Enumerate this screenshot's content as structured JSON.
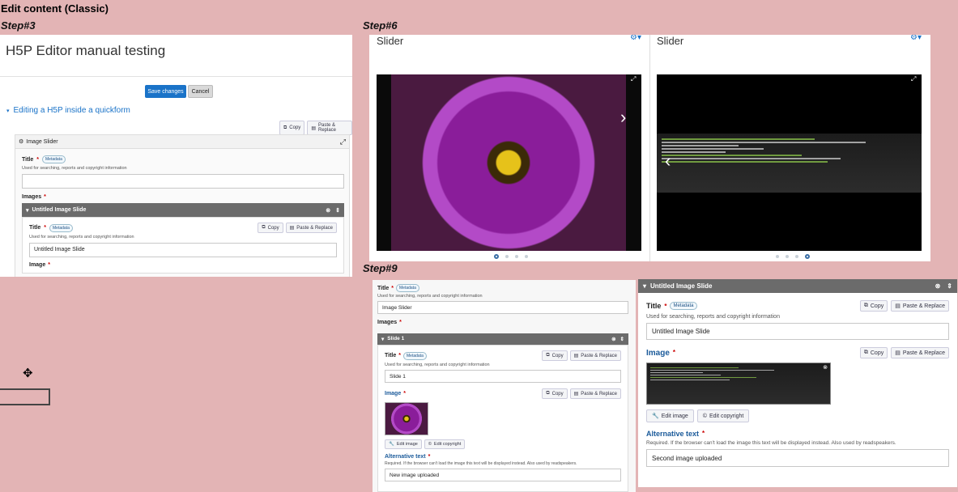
{
  "header": {
    "title": "Edit content (Classic)"
  },
  "steps": {
    "step3": "Step#3",
    "step6": "Step#6",
    "step9": "Step#9"
  },
  "step3": {
    "page_title": "H5P Editor manual testing",
    "save_label": "Save changes",
    "cancel_label": "Cancel",
    "section_label": "Editing a H5P inside a quickform",
    "copy_label": "Copy",
    "paste_label": "Paste & Replace",
    "widget_label": "Image Slider",
    "title_label": "Title",
    "metadata_label": "Metadata",
    "title_desc": "Used for searching, reports and copyright information",
    "images_label": "Images",
    "slide_bar_label": "Untitled Image Slide",
    "slide_title_value": "Untitled Image Slide",
    "image_label": "Image"
  },
  "step6": {
    "left_title": "Slider",
    "right_title": "Slider"
  },
  "step9": {
    "left": {
      "title_label": "Title",
      "metadata_label": "Metadata",
      "title_desc": "Used for searching, reports and copyright information",
      "title_value": "Image Slider",
      "images_label": "Images",
      "slide_bar_label": "Slide 1",
      "slide_title_label": "Title",
      "slide_title_value": "Slide 1",
      "copy_label": "Copy",
      "paste_label": "Paste & Replace",
      "image_label": "Image",
      "edit_image_label": "Edit image",
      "edit_copyright_label": "Edit copyright",
      "alt_label": "Alternative text",
      "alt_desc": "Required. If the browser can't load the image this text will be displayed instead. Also used by readspeakers.",
      "alt_value": "New image uploaded"
    },
    "right": {
      "bar_label": "Untitled Image Slide",
      "title_label": "Title",
      "metadata_label": "Metadata",
      "title_desc": "Used for searching, reports and copyright information",
      "title_value": "Untitled Image Slide",
      "copy_label": "Copy",
      "paste_label": "Paste & Replace",
      "image_label": "Image",
      "edit_image_label": "Edit image",
      "edit_copyright_label": "Edit copyright",
      "alt_label": "Alternative text",
      "alt_desc": "Required. If the browser can't load the image this text will be displayed instead. Also used by readspeakers.",
      "alt_value": "Second image uploaded"
    }
  },
  "colors": {
    "background": "#e3b4b5",
    "accent": "#1a73c8",
    "required": "#cc0000",
    "bar": "#6b6b6b"
  }
}
